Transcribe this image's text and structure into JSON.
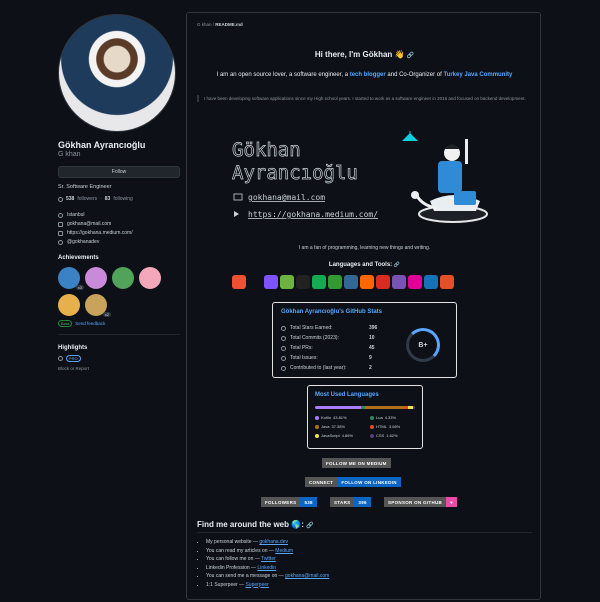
{
  "profile": {
    "name": "Gökhan Ayrancıoğlu",
    "username": "G khan",
    "follow_label": "Follow",
    "bio": "Sr. Software Engineer",
    "followers_count": "538",
    "followers_label": "followers",
    "sep": "·",
    "following_count": "83",
    "following_label": "following",
    "location": "Istanbul",
    "email": "gokhana@mail.com",
    "website": "https://gokhana.medium.com/",
    "twitter": "@gokhanadev"
  },
  "achievements": {
    "title": "Achievements",
    "badges": [
      {
        "name": "pull-shark",
        "count": "x3",
        "color": "#3b82c4"
      },
      {
        "name": "yolo",
        "count": "",
        "color": "#c98ad9"
      },
      {
        "name": "quickdraw",
        "count": "",
        "color": "#52a35a"
      },
      {
        "name": "heart-on-sleeve",
        "count": "",
        "color": "#f4a7b9"
      },
      {
        "name": "starstruck",
        "count": "",
        "color": "#e8b04a"
      },
      {
        "name": "pair-extraordinaire",
        "count": "x2",
        "color": "#c9a25c"
      }
    ],
    "beta": "Beta",
    "feedback": "Send feedback"
  },
  "highlights": {
    "title": "Highlights",
    "pro": "PRO",
    "block": "Block or Report"
  },
  "readme": {
    "crumb_user": "G khan",
    "crumb_file": "README.md",
    "title": "Hi there, I'm Gökhan 👋",
    "intro_a": "I am an open source lover, a software engineer, a",
    "intro_link1": "tech blogger",
    "intro_b": "and Co-Organizer of",
    "intro_link2": "Turkey Java Community",
    "quote": "I have been developing software applications since my High school years. I started to work as a software engineer in 2016 and focused on backend development.",
    "banner_first": "Gökhan",
    "banner_last": "Ayrancıoğlu",
    "banner_email": "gokhana@mail.com",
    "banner_url": "https://gokhana.medium.com/",
    "fan": "I am a fan of programming, learning new things and writing.",
    "languages_title": "Languages and Tools:",
    "tools": [
      {
        "name": "git",
        "color": "#f05032"
      },
      {
        "name": "java",
        "color": "#0d1117"
      },
      {
        "name": "kotlin",
        "color": "#7f52ff"
      },
      {
        "name": "spring",
        "color": "#6db33f"
      },
      {
        "name": "linux",
        "color": "#222"
      },
      {
        "name": "mongodb",
        "color": "#13aa52"
      },
      {
        "name": "nodejs",
        "color": "#339933"
      },
      {
        "name": "postgresql",
        "color": "#336791"
      },
      {
        "name": "rabbitmq",
        "color": "#ff6600"
      },
      {
        "name": "redis",
        "color": "#d82c20"
      },
      {
        "name": "bootstrap",
        "color": "#7952b3"
      },
      {
        "name": "graphql",
        "color": "#e10098"
      },
      {
        "name": "css3",
        "color": "#1572b6"
      },
      {
        "name": "html5",
        "color": "#e34f26"
      }
    ]
  },
  "stats": {
    "title": "Gökhan Ayrancıoğlu's GitHub Stats",
    "rows": [
      {
        "label": "Total Stars Earned:",
        "value": "396"
      },
      {
        "label": "Total Commits (2023):",
        "value": "10"
      },
      {
        "label": "Total PRs:",
        "value": "45"
      },
      {
        "label": "Total Issues:",
        "value": "9"
      },
      {
        "label": "Contributed to (last year):",
        "value": "2"
      }
    ],
    "grade": "B+"
  },
  "languages": {
    "title": "Most Used Languages",
    "items": [
      {
        "name": "Kotlin",
        "pct": "43.81%",
        "value": 43.81,
        "color": "#a97bff"
      },
      {
        "name": "Lua",
        "pct": "4.33%",
        "value": 4.33,
        "color": "#2c8a5c"
      },
      {
        "name": "Java",
        "pct": "37.38%",
        "value": 37.38,
        "color": "#b07219"
      },
      {
        "name": "HTML",
        "pct": "3.66%",
        "value": 3.66,
        "color": "#e34c26"
      },
      {
        "name": "JavaScript",
        "pct": "4.86%",
        "value": 4.86,
        "color": "#f1e05a"
      },
      {
        "name": "CSS",
        "pct": "1.62%",
        "value": 1.62,
        "color": "#563d7c"
      }
    ]
  },
  "badges": {
    "medium": "FOLLOW ME ON MEDIUM",
    "linkedin_l": "CONNECT",
    "linkedin_r": "FOLLOW ON LINKEDIN",
    "followers_l": "FOLLOWERS",
    "followers_r": "538",
    "stars_l": "STARS",
    "stars_r": "396",
    "sponsor_l": "SPONSOR ON GITHUB",
    "sponsor_r": "♥"
  },
  "find": {
    "title": "Find me around the web 🌎:",
    "items": [
      {
        "text": "My personal website — ",
        "link": "gokhana.dev"
      },
      {
        "text": "You can read my articles on — ",
        "link": "Medium"
      },
      {
        "text": "You can follow me on — ",
        "link": "Twitter"
      },
      {
        "text": "Linkedin Profession — ",
        "link": "Linkedin"
      },
      {
        "text": "You can send me a message on — ",
        "link": "gokhana@mail.com"
      },
      {
        "text": "1:1 Superpeer — ",
        "link": "Superpeer"
      }
    ]
  }
}
